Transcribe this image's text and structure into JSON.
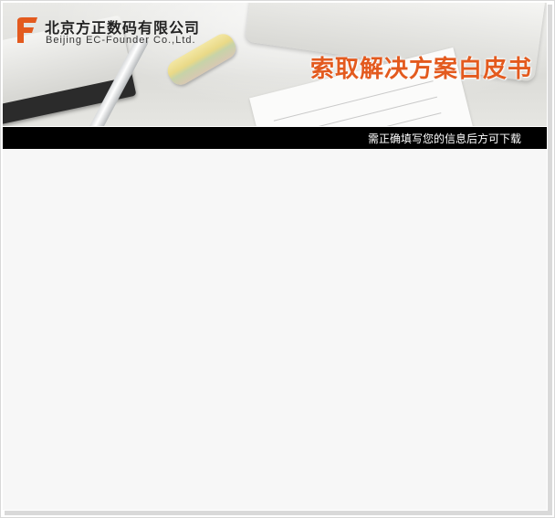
{
  "banner": {
    "logo_cn": "北京方正数码有限公司",
    "logo_en": "Beijing EC-Founder Co.,Ltd.",
    "title": "索取解决方案白皮书"
  },
  "notice": {
    "text": "需正确填写您的信息后方可下载"
  },
  "colors": {
    "brand_orange": "#e35a1e",
    "bar_black": "#000000",
    "content_bg": "#f7f7f7"
  }
}
